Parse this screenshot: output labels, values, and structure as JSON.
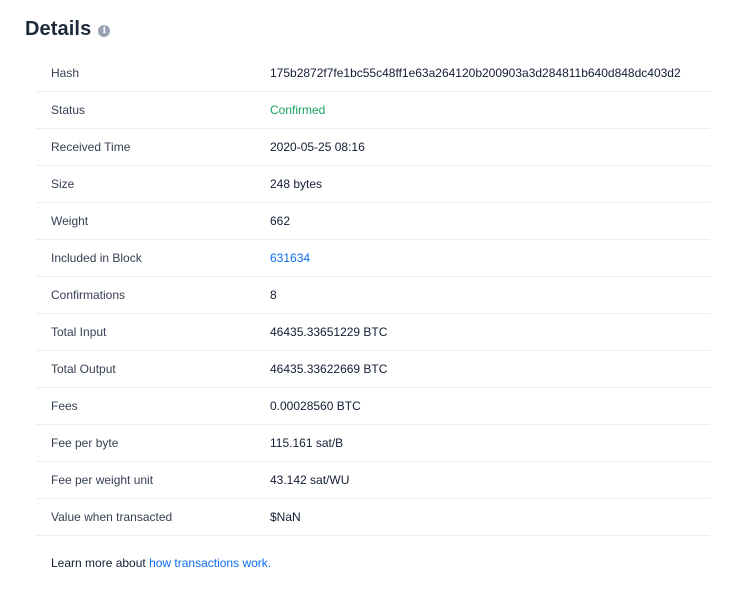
{
  "header": {
    "title": "Details",
    "info_icon_glyph": "i"
  },
  "details": {
    "rows": [
      {
        "label": "Hash",
        "value": "175b2872f7fe1bc55c48ff1e63a264120b200903a3d284811b640d848dc403d2"
      },
      {
        "label": "Status",
        "value": "Confirmed"
      },
      {
        "label": "Received Time",
        "value": "2020-05-25 08:16"
      },
      {
        "label": "Size",
        "value": "248 bytes"
      },
      {
        "label": "Weight",
        "value": "662"
      },
      {
        "label": "Included in Block",
        "value": "631634"
      },
      {
        "label": "Confirmations",
        "value": "8"
      },
      {
        "label": "Total Input",
        "value": "46435.33651229 BTC"
      },
      {
        "label": "Total Output",
        "value": "46435.33622669 BTC"
      },
      {
        "label": "Fees",
        "value": "0.00028560 BTC"
      },
      {
        "label": "Fee per byte",
        "value": "115.161 sat/B"
      },
      {
        "label": "Fee per weight unit",
        "value": "43.142 sat/WU"
      },
      {
        "label": "Value when transacted",
        "value": "$NaN"
      }
    ]
  },
  "footer": {
    "prefix": "Learn more about ",
    "link_text": "how transactions work."
  },
  "colors": {
    "confirmed": "#17a05e",
    "link": "#0c6cf2",
    "text": "#121d33",
    "divider": "#eceef2"
  }
}
